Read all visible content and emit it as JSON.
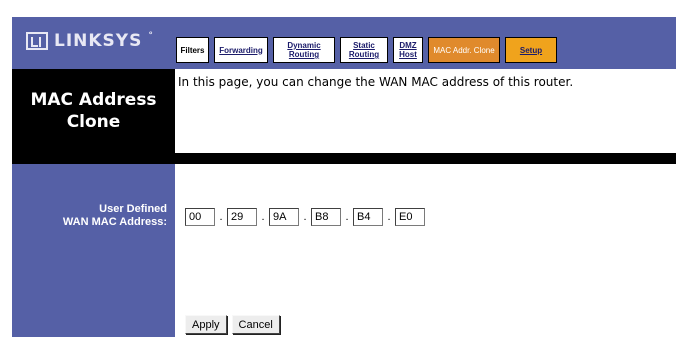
{
  "brand": {
    "name": "LINKSYS",
    "mark": "°"
  },
  "tabs": [
    {
      "label": "Filters",
      "state": "plain"
    },
    {
      "label": "Forwarding",
      "state": "link"
    },
    {
      "label": "Dynamic Routing",
      "state": "link"
    },
    {
      "label": "Static Routing",
      "state": "link"
    },
    {
      "label": "DMZ Host",
      "state": "link"
    },
    {
      "label": "MAC Addr. Clone",
      "state": "active"
    },
    {
      "label": "Setup",
      "state": "setup"
    }
  ],
  "page": {
    "title": "MAC Address\nClone",
    "description": "In this page, you can change the WAN MAC address of this router."
  },
  "form": {
    "mac_label": "User Defined\nWAN MAC Address:",
    "octets": [
      "00",
      "29",
      "9A",
      "B8",
      "B4",
      "E0"
    ],
    "separator": "."
  },
  "buttons": {
    "apply": "Apply",
    "cancel": "Cancel"
  },
  "colors": {
    "header_blue": "#5560a6",
    "active_tab": "#e08a2c",
    "setup_tab": "#f0a31c"
  }
}
